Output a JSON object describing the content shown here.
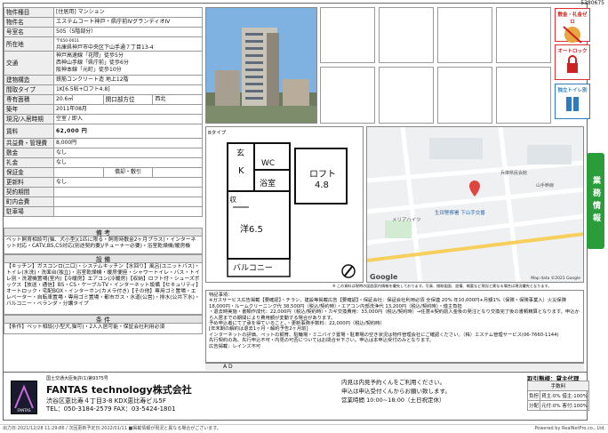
{
  "doc_number": "5380675",
  "spec": {
    "kind_label": "物件種目",
    "kind_value": "[住居用] マンション",
    "name_label": "物件名",
    "name_value": "エステムコート神戸・県庁前ⅣグランディオⅣ",
    "room_label": "号室名",
    "room_value": "505（5階部分）",
    "address_label": "所在地",
    "address_zip": "〒650-0011",
    "address_value": "兵庫県神戸市中央区下山手通７丁目13-4",
    "transit_label": "交通",
    "transit_lines": [
      "神戸高速線「花隈」徒歩5分",
      "西神山手線「県庁前」徒歩6分",
      "阪神本線「元町」徒歩10分"
    ],
    "structure_label": "建物構造",
    "structure_value": "鉄筋コンクリート造 地上12階",
    "layout_label": "間取タイプ",
    "layout_value": "1K[6.5帖+ロフト4.8]",
    "area_label": "専有面積",
    "area_value": "20.6㎡",
    "balcony_label": "開口部方位",
    "balcony_value": "西北",
    "built_label": "築年",
    "built_value": "2011年08月",
    "status_label": "現況/入居時期",
    "status_value": "空室 / 即入",
    "rent_label": "賃料",
    "rent_value": "62,000 円",
    "mgmt_label": "共益費・管理費",
    "mgmt_value": "8,000円",
    "deposit_label": "敷金",
    "deposit_value": "なし",
    "key_label": "礼金",
    "key_value": "なし",
    "guarantee_label": "保証金",
    "guarantee_value": "",
    "amort_label": "償却・敷引",
    "amort_value": "",
    "renewal_label": "更新料",
    "renewal_value": "なし",
    "contract_label": "契約期間",
    "contract_value": "",
    "insurance_label": "町内会費",
    "insurance_value": "",
    "parking_label": "駐車場",
    "parking_value": ""
  },
  "sections": {
    "remarks_title": "備 考",
    "remarks_text": "ペット飼育相談可(猫、犬小型)(1匹に限る・飼育時敷金2ヶ月プラス)・インターネット対応・CATV,BS,CS対応(別途契約要)/チューナー必要)・浴室乾燥機/暖房機",
    "equipment_title": "設 備",
    "equipment_text": "【キッチン】ガスコンロ(二口)・システムキッチン【水回り】風呂(ユニットバス)・トイレ(水洗)・洗面台(独立)・浴室乾燥機・暖房便座・シャワートイレ・バス・トイレ別・洗濯機置場(室内)【冷暖房】エアコン(冷暖房)【収納】ロフト付・シューズボックス【放送・通信】BS・CS・ケーブルTV・インターネット設備【セキュリティ】オートロック・宅配BOX・インターホン(カメラ付き)【その他】専用ゴミ置場・エレベーター・自転車置場・専用ゴミ置場・都市ガス・水道(公営)・排水(公共下水)・バルコニー・ベランダ・分譲タイプ",
    "conditions_title": "条 件",
    "conditions_text": "【条件】ペット相談(小型犬,猫可)・2人入居可能・保証会社利用必須"
  },
  "icons": {
    "money_label": "敷金・礼金ゼロ",
    "autolock_label": "オートロック",
    "toilet_label": "独立トイレ別"
  },
  "side_tab": "業務情報",
  "floorplan": {
    "type_label": "Bタイプ",
    "toilet": "WC",
    "bath": "浴室",
    "kitchen": "K",
    "entrance": "玄",
    "storage": "収",
    "room": "洋6.5",
    "loft_label": "ロフト",
    "loft_size": "4.8",
    "balcony": "バルコニー"
  },
  "map": {
    "station_label": "生田警察署 下山手交番",
    "place1": "メリアハイツ",
    "place2": "兵庫県民会館",
    "street1": "山手幹線",
    "copyright": "Map data ©2021 Google",
    "google": "Google"
  },
  "photo_caption": "※ この資料は現時の図面案内情報を優先しております。写真、間取図面、設備、概要など現況と異なる場合は現況優先となります。",
  "notes": {
    "title": "特記事項：",
    "lines": [
      "※ガスサービス広告掲載【要確認】・チラシ、建設等掲載広告【要確認】・保証会社：保証会社利用必須 全保連 20% 年10,000円+月額1%（保険・保険事業入）火災保険 18,000円・ルームクリーニング代 38,500円（税込/契約時）・エアコン内部洗浄代 13,200円（税込/契約時）・借主負担",
      "・退去時実施・書類作成代：22,000円（税込/契約時）・カギ交換費用：33,000円（税込/契約時）→任意※契約前入金後の発注となり交換完了後の書類精算となります。申込から入居までの期間により費用額が変動する場合があります。",
      "予め申込者にて了承を得ていること。・更新事務手数料：22,000円（税込/契約時）",
      "[年末期の解約は退去1ヶ月・解約予告2ヶ月前]",
      "インターネットの評価、ペットの飼育、駐輪場・ミニバイク置場・駐車場の空き状況は物件管理会社にご確認ください。（株）エステム管理サービス(06-7660-1144)",
      "先行契約の為、先行申込不可・内見の可否についてはお問合せ下さい。申込は本申込受付のみとなります。",
      "広告掲載：レインズ不可"
    ],
    "ad_label": "A D"
  },
  "footer": {
    "license": "国土交通大臣免許(1)第9375号",
    "company": "FANTAS technology株式会社",
    "address": "渋谷区恵比寿４丁目3-8 KDX恵比寿ビル5F",
    "phone": "TEL：050-3184-2579 FAX：03-5424-1801",
    "contact1": "内見は内見予約くんをご利用ください。",
    "contact2": "申込は申込受付くんからお願い致します。",
    "hours": "営業時間 10:00~18:00（土日祝定休）",
    "deal_label": "取引態様：貸主代理",
    "fee_header": "手数料",
    "fee_rows": [
      {
        "k": "負担",
        "v": "貸主:0% 借主:100%"
      },
      {
        "k": "分配",
        "v": "元付:0% 客付:100%"
      }
    ],
    "logo_text": "FANTAS"
  },
  "bottom_left": "出力日:2021/12/28 11:29:86 / 次回更新予定日:2022/01/11 ■掲載情報が現況と異なる場合がございます。",
  "bottom_right": "Powered by RealNetPro.co., Ltd."
}
